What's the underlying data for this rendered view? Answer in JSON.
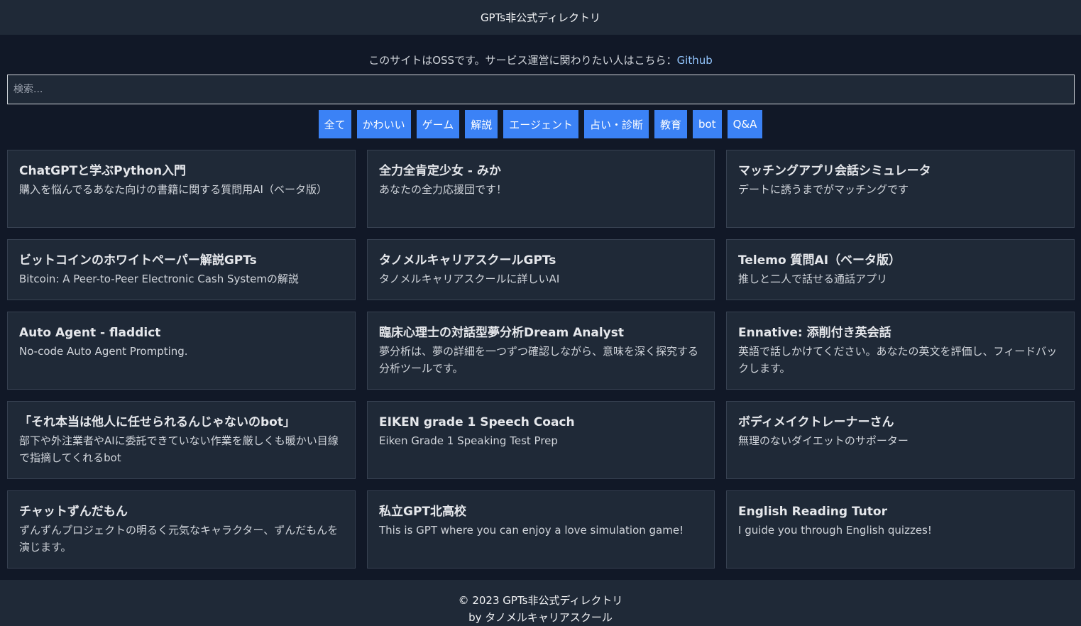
{
  "header": {
    "title": "GPTs非公式ディレクトリ"
  },
  "notice": {
    "text": "このサイトはOSSです。サービス運営に関わりたい人はこちら：",
    "link_label": "Github"
  },
  "search": {
    "placeholder": "検索...",
    "value": ""
  },
  "categories": [
    "全て",
    "かわいい",
    "ゲーム",
    "解説",
    "エージェント",
    "占い・診断",
    "教育",
    "bot",
    "Q&A"
  ],
  "cards": [
    {
      "title": "ChatGPTと学ぶPython入門",
      "desc": "購入を悩んでるあなた向けの書籍に関する質問用AI（ベータ版）"
    },
    {
      "title": "全力全肯定少女 - みか",
      "desc": "あなたの全力応援団です！"
    },
    {
      "title": "マッチングアプリ会話シミュレータ",
      "desc": "デートに誘うまでがマッチングです"
    },
    {
      "title": "ビットコインのホワイトペーパー解説GPTs",
      "desc": "Bitcoin: A Peer-to-Peer Electronic Cash Systemの解説"
    },
    {
      "title": "タノメルキャリアスクールGPTs",
      "desc": "タノメルキャリアスクールに詳しいAI"
    },
    {
      "title": "Telemo 質問AI（ベータ版）",
      "desc": "推しと二人で話せる通話アプリ"
    },
    {
      "title": "Auto Agent - fladdict",
      "desc": "No-code Auto Agent Prompting."
    },
    {
      "title": "臨床心理士の対話型夢分析Dream Analyst",
      "desc": "夢分析は、夢の詳細を一つずつ確認しながら、意味を深く探究する分析ツールです。"
    },
    {
      "title": "Ennative: 添削付き英会話",
      "desc": "英語で話しかけてください。あなたの英文を評価し、フィードバックします。"
    },
    {
      "title": "「それ本当は他人に任せられるんじゃないのbot」",
      "desc": "部下や外注業者やAIに委託できていない作業を厳しくも暖かい目線で指摘してくれるbot"
    },
    {
      "title": "EIKEN grade 1 Speech Coach",
      "desc": "Eiken Grade 1 Speaking Test Prep"
    },
    {
      "title": "ボディメイクトレーナーさん",
      "desc": "無理のないダイエットのサポーター"
    },
    {
      "title": "チャットずんだもん",
      "desc": "ずんずんプロジェクトの明るく元気なキャラクター、ずんだもんを演じます。"
    },
    {
      "title": "私立GPT北高校",
      "desc": "This is GPT where you can enjoy a love simulation game!"
    },
    {
      "title": "English Reading Tutor",
      "desc": "I guide you through English quizzes!"
    }
  ],
  "footer": {
    "line1": "© 2023 GPTs非公式ディレクトリ",
    "line2": "by タノメルキャリアスクール"
  }
}
